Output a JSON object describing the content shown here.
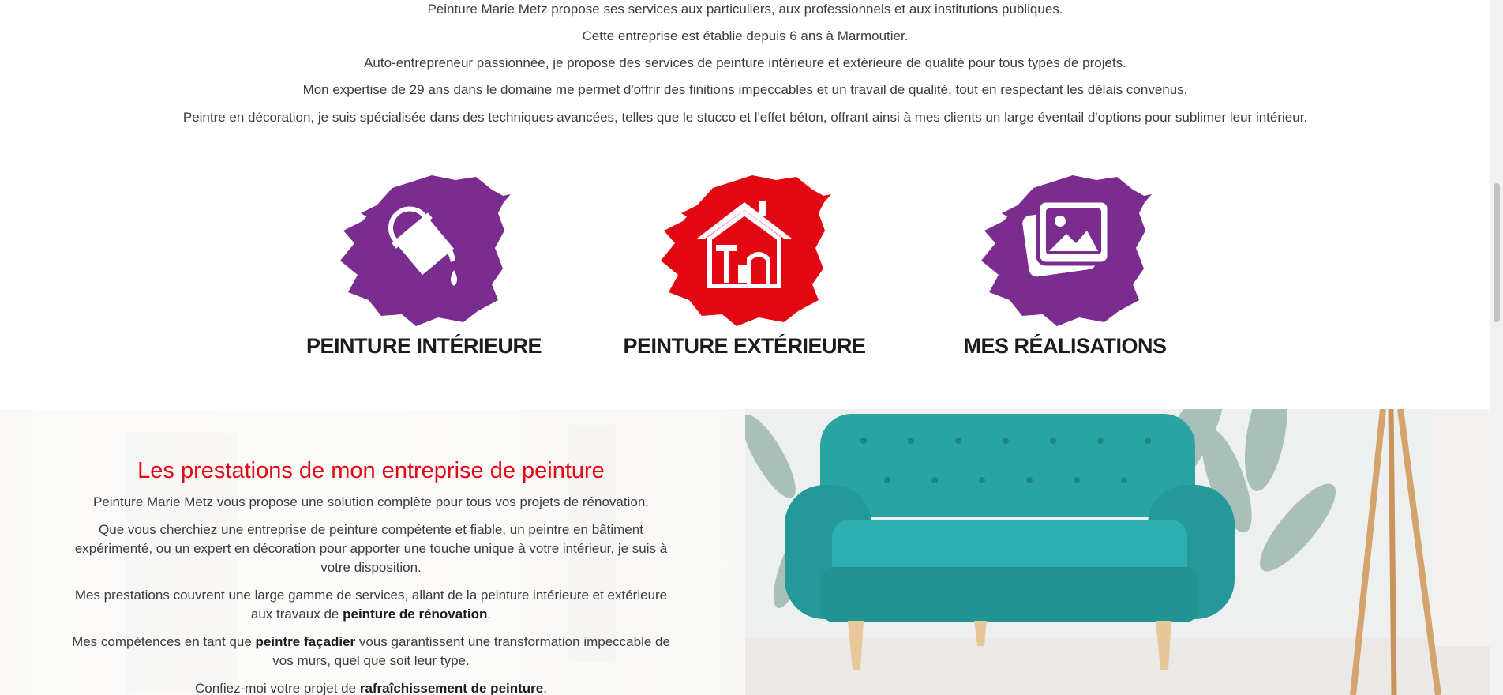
{
  "intro": {
    "lines": [
      "Peinture Marie Metz propose ses services aux particuliers, aux professionnels et aux institutions publiques.",
      "Cette entreprise est établie depuis 6 ans à Marmoutier.",
      "Auto-entrepreneur passionnée, je propose des services de peinture intérieure et extérieure de qualité pour tous types de projets.",
      "Mon expertise de 29 ans dans le domaine me permet d'offrir des finitions impeccables et un travail de qualité, tout en respectant les délais convenus.",
      "Peintre en décoration, je suis spécialisée dans des techniques avancées, telles que le stucco et l'effet béton, offrant ainsi à mes clients un large éventail d'options pour sublimer leur intérieur."
    ]
  },
  "services": [
    {
      "label": "PEINTURE INTÉRIEURE",
      "icon": "paint-bucket-icon",
      "color": "#7a2d8f"
    },
    {
      "label": "PEINTURE EXTÉRIEURE",
      "icon": "house-painting-icon",
      "color": "#e30613"
    },
    {
      "label": "MES RÉALISATIONS",
      "icon": "photo-gallery-icon",
      "color": "#7a2d8f"
    }
  ],
  "section": {
    "title": "Les prestations de mon entreprise de peinture",
    "p1": "Peinture Marie Metz vous propose une solution complète pour tous vos projets de rénovation.",
    "p2": "Que vous cherchiez une entreprise de peinture compétente et fiable, un peintre en bâtiment expérimenté, ou un expert en décoration pour apporter une touche unique à votre intérieur, je suis à votre disposition.",
    "p3_before": "Mes prestations couvrent une large gamme de services, allant de la peinture intérieure et extérieure aux travaux de ",
    "p3_bold": "peinture de rénovation",
    "p3_after": ".",
    "p4_before": "Mes compétences en tant que ",
    "p4_bold": "peintre façadier",
    "p4_after": " vous garantissent une transformation impeccable de vos murs, quel que soit leur type.",
    "p5_before": "Confiez-moi votre projet de ",
    "p5_bold": "rafraîchissement de peinture",
    "p5_after": "."
  },
  "colors": {
    "accent_red": "#e30613",
    "accent_purple": "#7a2d8f",
    "sofa": "#2aa3a3"
  }
}
